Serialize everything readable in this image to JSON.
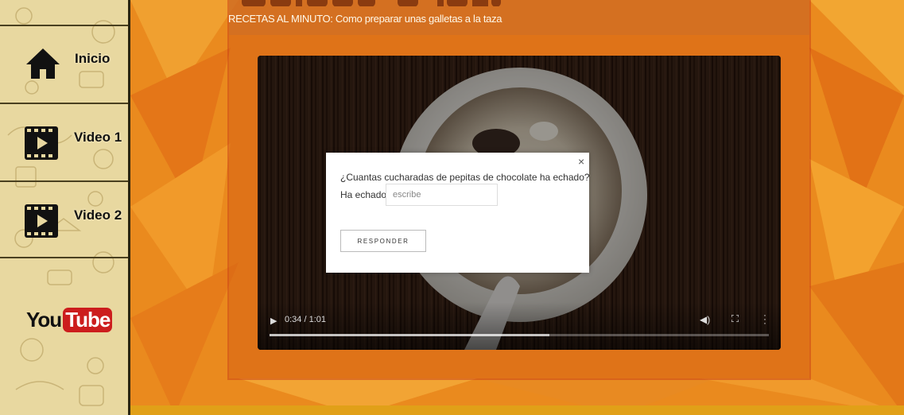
{
  "sidebar": {
    "items": [
      {
        "label": "Inicio",
        "icon": "home-icon"
      },
      {
        "label": "Video 1",
        "icon": "film-play-icon"
      },
      {
        "label": "Video 2",
        "icon": "film-play-icon"
      }
    ],
    "logo": {
      "you": "You",
      "tube": "Tube"
    }
  },
  "header": {
    "subtitle": "RECETAS AL MINUTO: Como preparar unas galletas a la taza"
  },
  "video": {
    "time": "0:34 / 1:01",
    "progress": 0.56
  },
  "modal": {
    "question": "¿Cuantas cucharadas de pepitas de chocolate ha echado?",
    "answer_label": "Ha echado",
    "answer_placeholder": "escribe",
    "submit_label": "RESPONDER",
    "close_symbol": "×"
  },
  "colors": {
    "background": "#e9881c",
    "sidebar": "#e8d8a0",
    "youtube_red": "#cc1d1d"
  }
}
